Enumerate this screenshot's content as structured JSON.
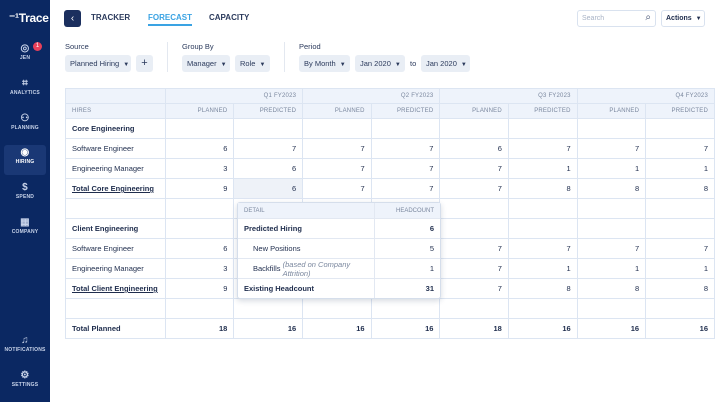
{
  "app": {
    "name": "Trace"
  },
  "sidebar": {
    "items": [
      {
        "label": "JEN",
        "icon": "user-icon",
        "badge": "1"
      },
      {
        "label": "ANALYTICS",
        "icon": "chart-icon"
      },
      {
        "label": "PLANNING",
        "icon": "people-icon"
      },
      {
        "label": "HIRING",
        "icon": "target-icon",
        "active": true
      },
      {
        "label": "SPEND",
        "icon": "dollar-icon"
      },
      {
        "label": "COMPANY",
        "icon": "building-icon"
      },
      {
        "label": "NOTIFICATIONS",
        "icon": "bell-icon"
      },
      {
        "label": "SETTINGS",
        "icon": "gear-icon"
      }
    ]
  },
  "tabs": [
    {
      "label": "TRACKER"
    },
    {
      "label": "FORECAST",
      "active": true
    },
    {
      "label": "CAPACITY"
    }
  ],
  "search": {
    "placeholder": "Search"
  },
  "actions_label": "Actions",
  "filters": {
    "source_label": "Source",
    "source_value": "Planned Hiring",
    "group_label": "Group By",
    "group_values": [
      "Manager",
      "Role"
    ],
    "period_label": "Period",
    "period_value": "By Month",
    "from": "Jan 2020",
    "to_label": "to",
    "to": "Jan 2020"
  },
  "table": {
    "quarters": [
      "Q1 FY2023",
      "Q2 FY2023",
      "Q3 FY2023",
      "Q4 FY2023"
    ],
    "hires_header": "HIRES",
    "planned_header": "PLANNED",
    "predicted_header": "PREDICTED",
    "rows": [
      {
        "name": "Core Engineering",
        "type": "group",
        "values": [
          "",
          "",
          "",
          "",
          "",
          "",
          "",
          ""
        ]
      },
      {
        "name": "Software Engineer",
        "type": "item",
        "values": [
          "6",
          "7",
          "7",
          "7",
          "6",
          "7",
          "7",
          "7"
        ]
      },
      {
        "name": "Engineering Manager",
        "type": "item",
        "values": [
          "3",
          "6",
          "7",
          "7",
          "7",
          "1",
          "1",
          "1"
        ]
      },
      {
        "name": "Total Core Engineering",
        "type": "total",
        "values": [
          "9",
          "6",
          "7",
          "7",
          "7",
          "8",
          "8",
          "8"
        ]
      },
      {
        "name": "",
        "type": "blank",
        "values": [
          "",
          "",
          "",
          "",
          "",
          "",
          "",
          ""
        ]
      },
      {
        "name": "Client Engineering",
        "type": "group",
        "values": [
          "",
          "",
          "",
          "",
          "",
          "",
          "",
          ""
        ]
      },
      {
        "name": "Software Engineer",
        "type": "item",
        "values": [
          "6",
          "",
          "",
          "",
          "7",
          "7",
          "7",
          "7"
        ]
      },
      {
        "name": "Engineering Manager",
        "type": "item",
        "values": [
          "3",
          "",
          "",
          "",
          "7",
          "1",
          "1",
          "1"
        ]
      },
      {
        "name": "Total Client Engineering",
        "type": "total",
        "values": [
          "9",
          "",
          "",
          "",
          "7",
          "8",
          "8",
          "8"
        ]
      },
      {
        "name": "",
        "type": "blank",
        "values": [
          "",
          "",
          "",
          "",
          "",
          "",
          "",
          ""
        ]
      },
      {
        "name": "Total Planned",
        "type": "grand",
        "values": [
          "18",
          "16",
          "16",
          "16",
          "18",
          "16",
          "16",
          "16"
        ]
      }
    ]
  },
  "tooltip": {
    "detail_header": "DETAIL",
    "headcount_header": "HEADCOUNT",
    "rows": [
      {
        "label": "Predicted Hiring",
        "value": "6"
      },
      {
        "label": "New Positions",
        "value": "5"
      },
      {
        "label": "Backfills",
        "note": "(based on Company Attrition)",
        "value": "1"
      },
      {
        "label": "Existing Headcount",
        "value": "31"
      }
    ]
  }
}
